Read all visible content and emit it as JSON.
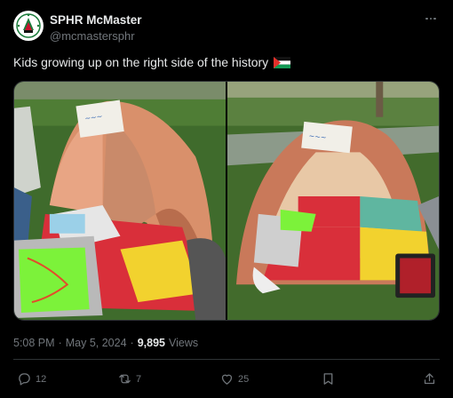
{
  "author": {
    "display_name": "SPHR McMaster",
    "handle": "@mcmastersphr"
  },
  "tweet": {
    "text": "Kids growing up on the right side of the history"
  },
  "meta": {
    "time": "5:08 PM",
    "separator": "·",
    "date": "May 5, 2024",
    "separator2": "·",
    "views_count": "9,895",
    "views_label": "Views"
  },
  "actions": {
    "replies": "12",
    "reposts": "7",
    "likes": "25"
  },
  "icons": {
    "more": "more-horizontal-icon",
    "reply": "reply-icon",
    "repost": "repost-icon",
    "like": "heart-icon",
    "bookmark": "bookmark-icon",
    "share": "share-icon",
    "flag": "palestine-flag-icon"
  },
  "colors": {
    "background": "#000000",
    "text": "#e7e9ea",
    "muted": "#71767b",
    "border": "#2f3336"
  }
}
